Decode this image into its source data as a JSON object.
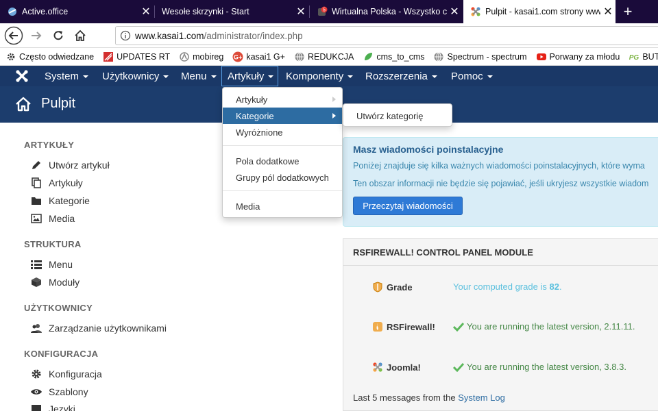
{
  "browser": {
    "tabs": [
      {
        "title": "Active.office",
        "favicon": "active-office-icon"
      },
      {
        "title": "Wesołe skrzynki - Start",
        "favicon": "none"
      },
      {
        "title": "Wirtualna Polska - Wszystko co",
        "favicon": "wp-icon",
        "badge": "5"
      },
      {
        "title": "Pulpit - kasai1.com strony www",
        "favicon": "joomla-icon",
        "active": true
      }
    ],
    "url_host": "www.kasai1.com",
    "url_path": "/administrator/index.php",
    "bookmarks": [
      {
        "label": "Często odwiedzane",
        "icon": "gear-icon"
      },
      {
        "label": "UPDATES RT",
        "icon": "rt-icon"
      },
      {
        "label": "mobireg",
        "icon": "mobireg-icon"
      },
      {
        "label": "kasai1 G+",
        "icon": "gplus-icon"
      },
      {
        "label": "REDUKCJA",
        "icon": "globe-icon"
      },
      {
        "label": "cms_to_cms",
        "icon": "leaf-icon"
      },
      {
        "label": "Spectrum - spectrum",
        "icon": "globe-icon"
      },
      {
        "label": "Porwany za młodu",
        "icon": "youtube-icon"
      },
      {
        "label": "BUTY sport",
        "icon": "pg-icon"
      },
      {
        "label": "kasai1",
        "icon": "youtube-icon"
      }
    ]
  },
  "admin_menu": {
    "items": [
      "System",
      "Użytkownicy",
      "Menu",
      "Artykuły",
      "Komponenty",
      "Rozszerzenia",
      "Pomoc"
    ],
    "open_item": "Artykuły"
  },
  "dropdown": {
    "items": [
      "Artykuły",
      "Kategorie",
      "Wyróżnione",
      "Pola dodatkowe",
      "Grupy pól dodatkowych",
      "Media"
    ],
    "active": "Kategorie",
    "submenu_item": "Utwórz kategorię"
  },
  "page_title": "Pulpit",
  "sidebar": {
    "sections": [
      {
        "heading": "ARTYKUŁY",
        "items": [
          {
            "label": "Utwórz artykuł",
            "icon": "pencil-icon"
          },
          {
            "label": "Artykuły",
            "icon": "copy-icon"
          },
          {
            "label": "Kategorie",
            "icon": "folder-icon"
          },
          {
            "label": "Media",
            "icon": "image-icon"
          }
        ]
      },
      {
        "heading": "STRUKTURA",
        "items": [
          {
            "label": "Menu",
            "icon": "list-icon"
          },
          {
            "label": "Moduły",
            "icon": "cube-icon"
          }
        ]
      },
      {
        "heading": "UŻYTKOWNICY",
        "items": [
          {
            "label": "Zarządzanie użytkownikami",
            "icon": "users-icon"
          }
        ]
      },
      {
        "heading": "KONFIGURACJA",
        "items": [
          {
            "label": "Konfiguracja",
            "icon": "cog-icon"
          },
          {
            "label": "Szablony",
            "icon": "eye-icon"
          },
          {
            "label": "Języki",
            "icon": "comment-icon"
          }
        ]
      }
    ]
  },
  "postinstall": {
    "title": "Masz wiadomości poinstalacyjne",
    "line1": "Poniżej znajduje się kilka ważnych wiadomości poinstalacyjnych, które wyma",
    "line2": "Ten obszar informacji nie będzie się pojawiać, jeśli ukryjesz wszystkie wiadom",
    "button": "Przeczytaj wiadomości"
  },
  "rsfirewall": {
    "title": "RSFIREWALL! CONTROL PANEL MODULE",
    "grade_label": "Grade",
    "grade_text": "Your computed grade is",
    "grade_value": "82",
    "grade_suffix": ".",
    "rs_label": "RSFirewall!",
    "rs_text": "You are running the latest version, 2.11.11.",
    "joomla_label": "Joomla!",
    "joomla_text": "You are running the latest version, 3.8.3.",
    "log_text": "Last 5 messages from the",
    "log_link": "System Log"
  },
  "colors": {
    "admin_bar": "#1a3867",
    "subheader": "#1c3d6d",
    "accent": "#2d6ca2",
    "button": "#2e7ad6",
    "ok_green": "#468847",
    "info_blue": "#5bc0de"
  }
}
